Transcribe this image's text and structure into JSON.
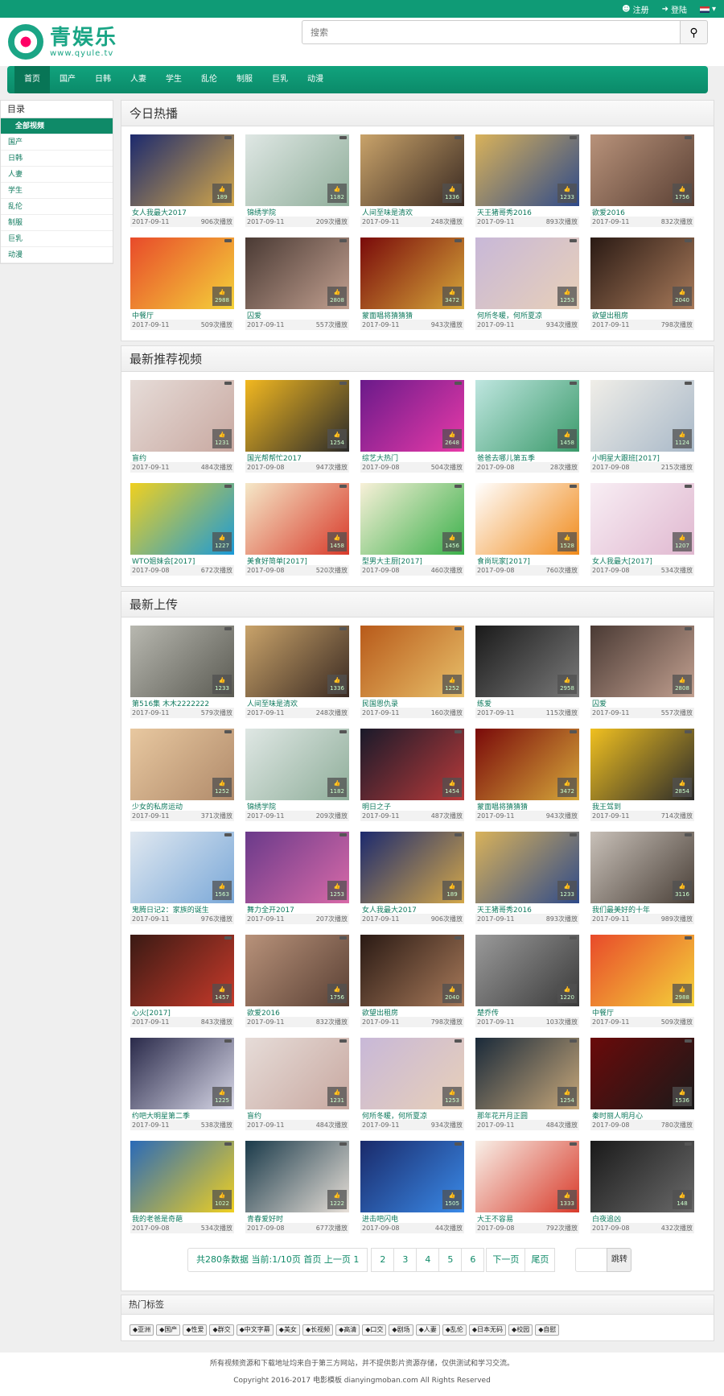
{
  "topbar": {
    "register": "注册",
    "login": "登陆"
  },
  "logo": {
    "title": "青娱乐",
    "sub": "www.qyule.tv"
  },
  "search": {
    "placeholder": "搜索"
  },
  "nav": [
    "首页",
    "国产",
    "日韩",
    "人妻",
    "学生",
    "乱伦",
    "制服",
    "巨乳",
    "动漫"
  ],
  "sidebar": {
    "title": "目录",
    "items": [
      "全部视频",
      "国产",
      "日韩",
      "人妻",
      "学生",
      "乱伦",
      "制服",
      "巨乳",
      "动漫"
    ]
  },
  "sections": [
    {
      "title": "今日热播",
      "cards": [
        {
          "title": "女人我最大2017",
          "date": "2017-09-11",
          "plays": "906次播放",
          "likes": "189",
          "c1": "#1c2a6e",
          "c2": "#d4a84a"
        },
        {
          "title": "锦绣学院",
          "date": "2017-09-11",
          "plays": "209次播放",
          "likes": "1182",
          "c1": "#dfe7e4",
          "c2": "#8fae9a"
        },
        {
          "title": "人间至味是清欢",
          "date": "2017-09-11",
          "plays": "248次播放",
          "likes": "1336",
          "c1": "#c9a36a",
          "c2": "#3a2a22"
        },
        {
          "title": "天王猪哥秀2016",
          "date": "2017-09-11",
          "plays": "893次播放",
          "likes": "1233",
          "c1": "#d9b25a",
          "c2": "#2e4a8a"
        },
        {
          "title": "欲爱2016",
          "date": "2017-09-11",
          "plays": "832次播放",
          "likes": "1756",
          "c1": "#b8927a",
          "c2": "#5a4034"
        },
        {
          "title": "中餐厅",
          "date": "2017-09-11",
          "plays": "509次播放",
          "likes": "2988",
          "c1": "#e84a2a",
          "c2": "#f4d33a"
        },
        {
          "title": "囚爱",
          "date": "2017-09-11",
          "plays": "557次播放",
          "likes": "2808",
          "c1": "#4a3a34",
          "c2": "#c2a090"
        },
        {
          "title": "蒙面唱将猜猜猜",
          "date": "2017-09-11",
          "plays": "943次播放",
          "likes": "3472",
          "c1": "#7a0a0a",
          "c2": "#d6a83a"
        },
        {
          "title": "何所冬暖，何所夏凉",
          "date": "2017-09-11",
          "plays": "934次播放",
          "likes": "1253",
          "c1": "#c8b8d8",
          "c2": "#e8d0b8"
        },
        {
          "title": "欲望出租房",
          "date": "2017-09-11",
          "plays": "798次播放",
          "likes": "2040",
          "c1": "#2a1a14",
          "c2": "#a87a5a"
        }
      ]
    },
    {
      "title": "最新推荐视频",
      "cards": [
        {
          "title": "盲约",
          "date": "2017-09-11",
          "plays": "484次播放",
          "likes": "1231",
          "c1": "#e6dcd8",
          "c2": "#c8a8a0"
        },
        {
          "title": "国光帮帮忙2017",
          "date": "2017-09-08",
          "plays": "947次播放",
          "likes": "1254",
          "c1": "#f2b820",
          "c2": "#2a2a2a"
        },
        {
          "title": "综艺大热门",
          "date": "2017-09-08",
          "plays": "504次播放",
          "likes": "2648",
          "c1": "#6a1a8a",
          "c2": "#e83aa8"
        },
        {
          "title": "爸爸去哪儿第五季",
          "date": "2017-09-08",
          "plays": "28次播放",
          "likes": "1458",
          "c1": "#bfe6e0",
          "c2": "#3a9a6a"
        },
        {
          "title": "小明星大跟班[2017]",
          "date": "2017-09-08",
          "plays": "215次播放",
          "likes": "1124",
          "c1": "#f0eee8",
          "c2": "#a8b8c8"
        },
        {
          "title": "WTO姐妹会[2017]",
          "date": "2017-09-08",
          "plays": "672次播放",
          "likes": "1227",
          "c1": "#f0d020",
          "c2": "#1a9ad8"
        },
        {
          "title": "美食好简单[2017]",
          "date": "2017-09-08",
          "plays": "520次播放",
          "likes": "1458",
          "c1": "#f5e8c8",
          "c2": "#d83a2a"
        },
        {
          "title": "型男大主厨[2017]",
          "date": "2017-09-08",
          "plays": "460次播放",
          "likes": "1456",
          "c1": "#f8f0d8",
          "c2": "#3ab04a"
        },
        {
          "title": "食尚玩家[2017]",
          "date": "2017-09-08",
          "plays": "760次播放",
          "likes": "1528",
          "c1": "#ffffff",
          "c2": "#f08a1a"
        },
        {
          "title": "女人我最大[2017]",
          "date": "2017-09-08",
          "plays": "534次播放",
          "likes": "1207",
          "c1": "#f8eef4",
          "c2": "#e0b8d0"
        }
      ]
    },
    {
      "title": "最新上传",
      "cards": [
        {
          "title": "第516集 木木2222222",
          "date": "2017-09-11",
          "plays": "579次播放",
          "likes": "1233",
          "c1": "#b8b8b0",
          "c2": "#5a5a52"
        },
        {
          "title": "人间至味是清欢",
          "date": "2017-09-11",
          "plays": "248次播放",
          "likes": "1336",
          "c1": "#c9a36a",
          "c2": "#3a2a22"
        },
        {
          "title": "民国恩仇录",
          "date": "2017-09-11",
          "plays": "160次播放",
          "likes": "1252",
          "c1": "#b85a1a",
          "c2": "#e8c06a"
        },
        {
          "title": "练爱",
          "date": "2017-09-11",
          "plays": "115次播放",
          "likes": "2958",
          "c1": "#1a1a1a",
          "c2": "#7a7a7a"
        },
        {
          "title": "囚爱",
          "date": "2017-09-11",
          "plays": "557次播放",
          "likes": "2808",
          "c1": "#4a3a34",
          "c2": "#c2a090"
        },
        {
          "title": "少女的私房运动",
          "date": "2017-09-11",
          "plays": "371次播放",
          "likes": "1252",
          "c1": "#e8c8a0",
          "c2": "#b08a6a"
        },
        {
          "title": "锦绣学院",
          "date": "2017-09-11",
          "plays": "209次播放",
          "likes": "1182",
          "c1": "#dfe7e4",
          "c2": "#8fae9a"
        },
        {
          "title": "明日之子",
          "date": "2017-09-11",
          "plays": "487次播放",
          "likes": "1454",
          "c1": "#1a1a2a",
          "c2": "#b83a3a"
        },
        {
          "title": "蒙面唱将猜猜猜",
          "date": "2017-09-11",
          "plays": "943次播放",
          "likes": "3472",
          "c1": "#7a0a0a",
          "c2": "#d6a83a"
        },
        {
          "title": "我王驾到",
          "date": "2017-09-11",
          "plays": "714次播放",
          "likes": "2854",
          "c1": "#f0c020",
          "c2": "#2a2a2a"
        },
        {
          "title": "鬼腾日记2：家族的诞生",
          "date": "2017-09-11",
          "plays": "976次播放",
          "likes": "1563",
          "c1": "#e0e8f0",
          "c2": "#7aa8d8"
        },
        {
          "title": "舞力全开2017",
          "date": "2017-09-11",
          "plays": "207次播放",
          "likes": "1253",
          "c1": "#6a3a8a",
          "c2": "#d86aa8"
        },
        {
          "title": "女人我最大2017",
          "date": "2017-09-11",
          "plays": "906次播放",
          "likes": "189",
          "c1": "#1c2a6e",
          "c2": "#d4a84a"
        },
        {
          "title": "天王猪哥秀2016",
          "date": "2017-09-11",
          "plays": "893次播放",
          "likes": "1233",
          "c1": "#d9b25a",
          "c2": "#2e4a8a"
        },
        {
          "title": "我们最美好的十年",
          "date": "2017-09-11",
          "plays": "989次播放",
          "likes": "3116",
          "c1": "#c8c0b8",
          "c2": "#4a4038"
        },
        {
          "title": "心火[2017]",
          "date": "2017-09-11",
          "plays": "843次播放",
          "likes": "1457",
          "c1": "#3a1a14",
          "c2": "#c83a2a"
        },
        {
          "title": "欲爱2016",
          "date": "2017-09-11",
          "plays": "832次播放",
          "likes": "1756",
          "c1": "#b8927a",
          "c2": "#5a4034"
        },
        {
          "title": "欲望出租房",
          "date": "2017-09-11",
          "plays": "798次播放",
          "likes": "2040",
          "c1": "#2a1a14",
          "c2": "#a87a5a"
        },
        {
          "title": "楚乔传",
          "date": "2017-09-11",
          "plays": "103次播放",
          "likes": "1220",
          "c1": "#9a9a9a",
          "c2": "#3a3a3a"
        },
        {
          "title": "中餐厅",
          "date": "2017-09-11",
          "plays": "509次播放",
          "likes": "2988",
          "c1": "#e84a2a",
          "c2": "#f4d33a"
        },
        {
          "title": "约吧大明星第二季",
          "date": "2017-09-11",
          "plays": "538次播放",
          "likes": "1225",
          "c1": "#2a2a4a",
          "c2": "#d8d8e8"
        },
        {
          "title": "盲约",
          "date": "2017-09-11",
          "plays": "484次播放",
          "likes": "1231",
          "c1": "#e6dcd8",
          "c2": "#c8a8a0"
        },
        {
          "title": "何所冬暖，何所夏凉",
          "date": "2017-09-11",
          "plays": "934次播放",
          "likes": "1253",
          "c1": "#c8b8d8",
          "c2": "#e8d0b8"
        },
        {
          "title": "那年花开月正圆",
          "date": "2017-09-11",
          "plays": "484次播放",
          "likes": "1254",
          "c1": "#1a2a3a",
          "c2": "#c8a87a"
        },
        {
          "title": "秦时丽人明月心",
          "date": "2017-09-08",
          "plays": "780次播放",
          "likes": "1536",
          "c1": "#6a0a0a",
          "c2": "#1a1a1a"
        },
        {
          "title": "我的老爸是奇葩",
          "date": "2017-09-08",
          "plays": "534次播放",
          "likes": "1022",
          "c1": "#2a6ab8",
          "c2": "#f0d020"
        },
        {
          "title": "青春爱好时",
          "date": "2017-09-08",
          "plays": "677次播放",
          "likes": "1222",
          "c1": "#1a3a4a",
          "c2": "#e8e0d8"
        },
        {
          "title": "进击吧闪电",
          "date": "2017-09-08",
          "plays": "44次播放",
          "likes": "1505",
          "c1": "#1a2a6a",
          "c2": "#3a8ae8"
        },
        {
          "title": "大王不容易",
          "date": "2017-09-08",
          "plays": "792次播放",
          "likes": "1333",
          "c1": "#f8f0e8",
          "c2": "#d83a2a"
        },
        {
          "title": "白夜追凶",
          "date": "2017-09-08",
          "plays": "432次播放",
          "likes": "148",
          "c1": "#1a1a1a",
          "c2": "#6a6a6a"
        }
      ]
    }
  ],
  "pager": {
    "info_prefix": "共",
    "total": "280",
    "info_mid": "条数据 当前:",
    "current": "1/10页",
    "first": "首页",
    "prev": "上一页",
    "cur_num": "1",
    "pages": [
      "2",
      "3",
      "4",
      "5",
      "6"
    ],
    "next": "下一页",
    "last": "尾页",
    "jump": "跳转"
  },
  "tags": {
    "title": "热门标签",
    "items": [
      "亚洲",
      "国产",
      "性爱",
      "群交",
      "中文字幕",
      "美女",
      "长视频",
      "高清",
      "口交",
      "剧场",
      "人妻",
      "乱伦",
      "日本无码",
      "校园",
      "自慰"
    ]
  },
  "footer": {
    "line1": "所有视频资源和下载地址均来自于第三方网站，并不提供影片资源存储，仅供测试和学习交流。",
    "line2": "Copyright 2016-2017 电影模板 dianyingmoban.com All Rights Reserved"
  }
}
